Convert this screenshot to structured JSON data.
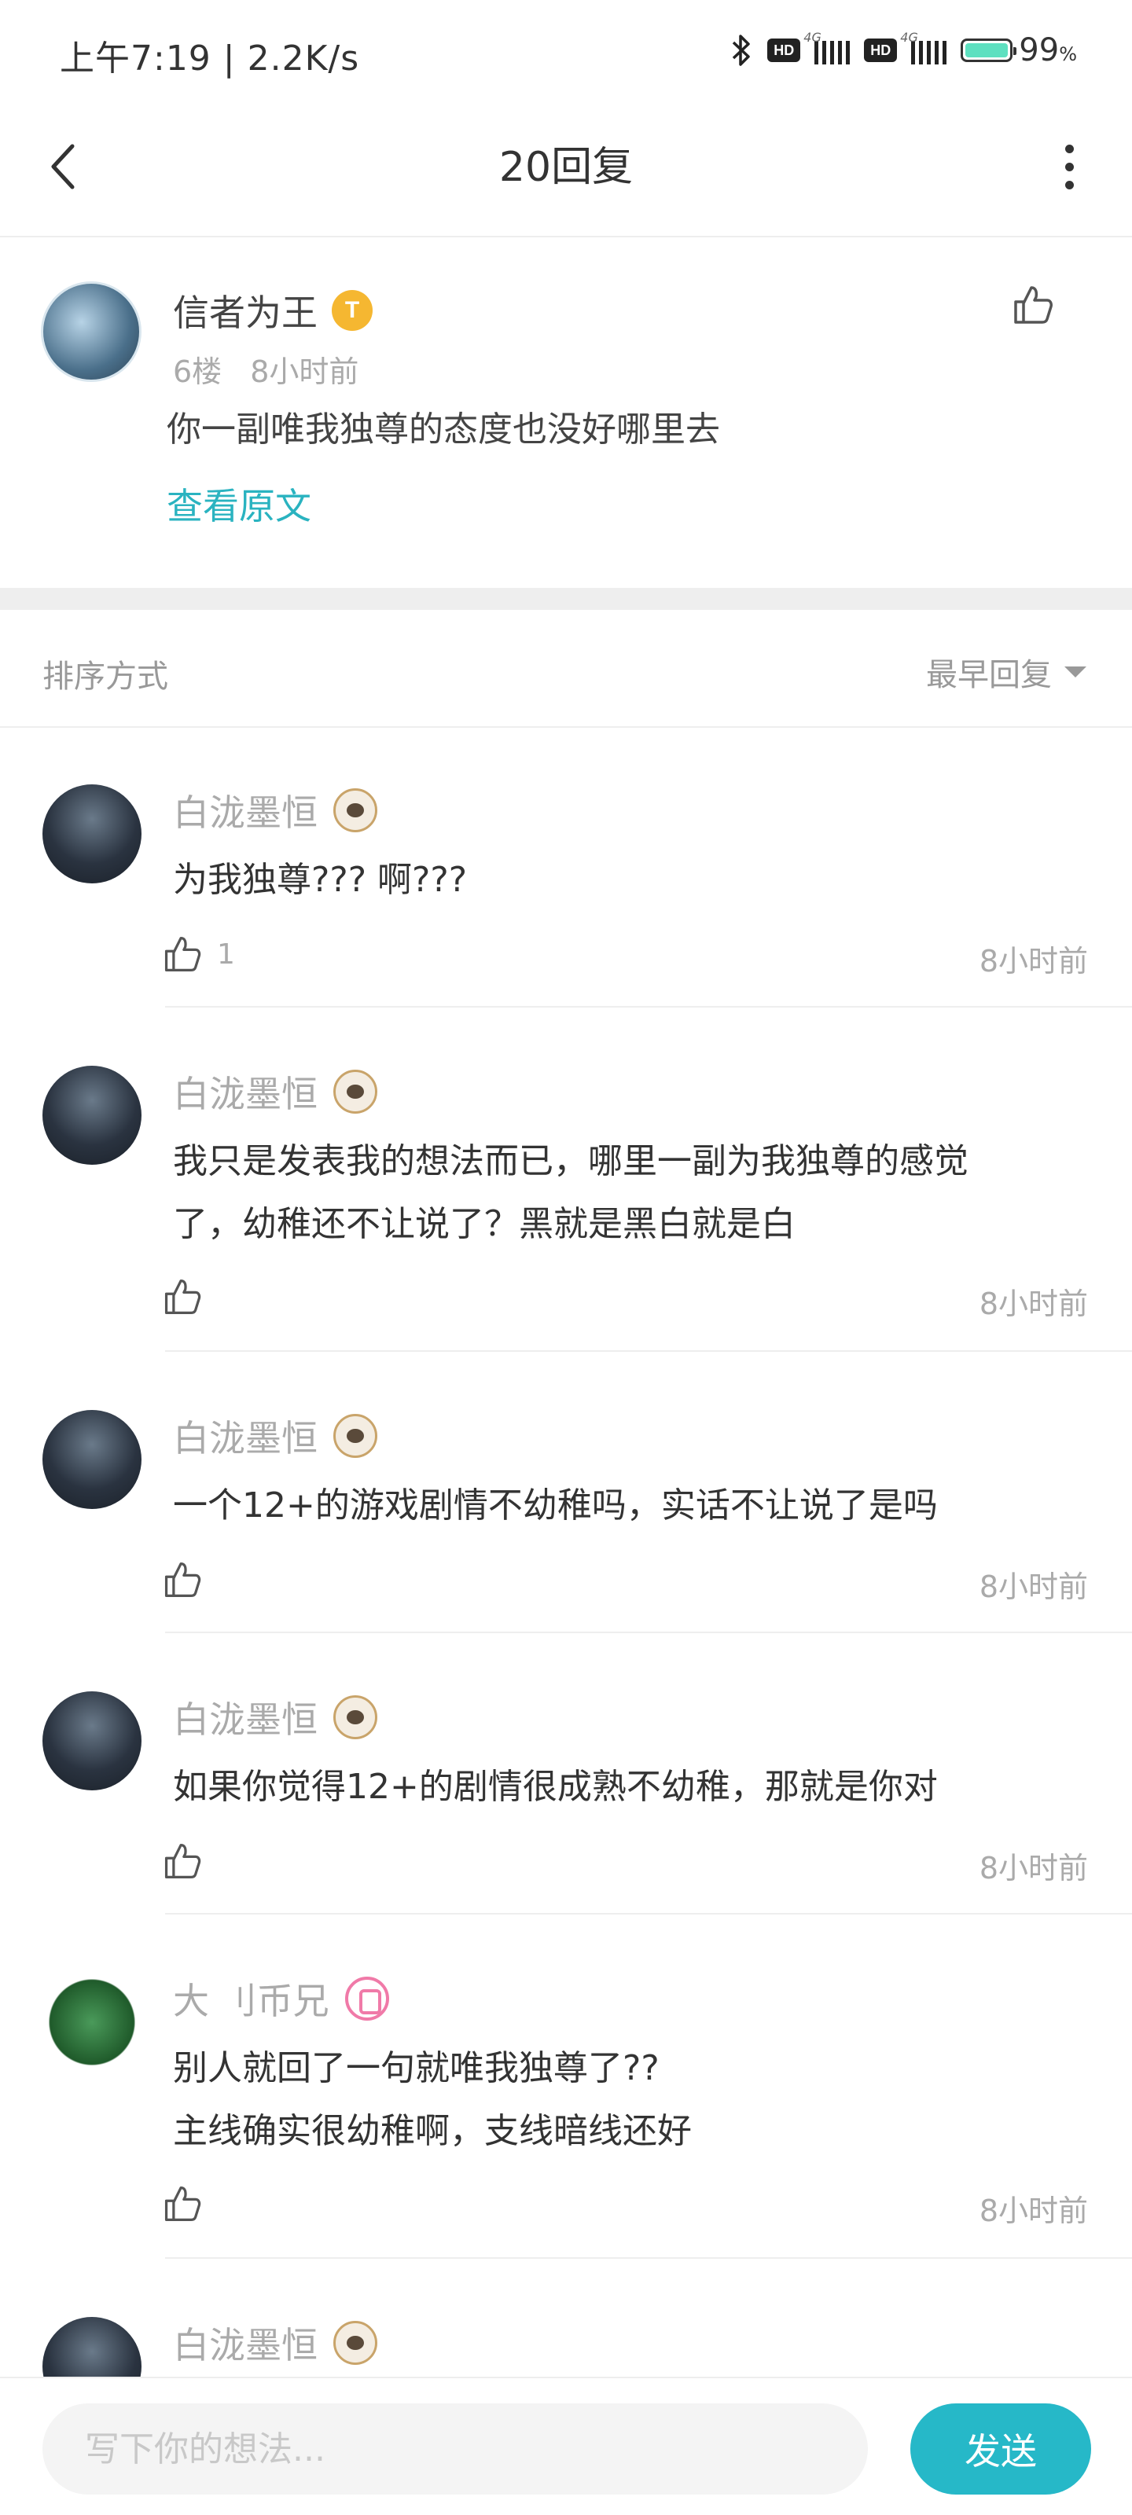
{
  "status_bar": {
    "time_speed": "上午7:19 | 2.2K/s",
    "hd_label": "HD",
    "network_tag": "4G",
    "battery_percent": "99",
    "battery_unit": "%",
    "battery_level": 0.99,
    "icons": [
      "bluetooth-icon",
      "signal-icon",
      "battery-icon"
    ]
  },
  "header": {
    "title": "20回复",
    "back_icon": "chevron-left-icon",
    "more_icon": "more-vertical-icon"
  },
  "original_comment": {
    "username": "信者为王",
    "badge_letter": "T",
    "floor": "6楼",
    "time": "8小时前",
    "text": "你一副唯我独尊的态度也没好哪里去",
    "view_original": "查看原文"
  },
  "sort": {
    "label": "排序方式",
    "selected": "最早回复"
  },
  "replies": [
    {
      "username": "白泷墨恒",
      "text_lines": [
        "为我独尊??? 啊???"
      ],
      "likes": "1",
      "time": "8小时前"
    },
    {
      "username": "白泷墨恒",
      "text_lines": [
        "我只是发表我的想法而已，哪里一副为我独尊的感觉",
        "了，幼稚还不让说了？黑就是黑白就是白"
      ],
      "likes": "",
      "time": "8小时前"
    },
    {
      "username": "白泷墨恒",
      "text_lines": [
        "一个12+的游戏剧情不幼稚吗，实话不让说了是吗"
      ],
      "likes": "",
      "time": "8小时前"
    },
    {
      "username": "白泷墨恒",
      "text_lines": [
        "如果你觉得12+的剧情很成熟不幼稚，那就是你对"
      ],
      "likes": "",
      "time": "8小时前"
    },
    {
      "username": "大 刂币兄",
      "text_lines": [
        "别人就回了一句就唯我独尊了??",
        "主线确实很幼稚啊，支线暗线还好"
      ],
      "likes": "",
      "time": "8小时前"
    },
    {
      "username": "白泷墨恒",
      "text_lines": [],
      "likes": "",
      "time": ""
    }
  ],
  "input_bar": {
    "placeholder": "写下你的想法...",
    "send_label": "发送"
  },
  "colors": {
    "accent": "#26b8c8",
    "link": "#2ab3c0",
    "muted": "#aaaaaa"
  }
}
